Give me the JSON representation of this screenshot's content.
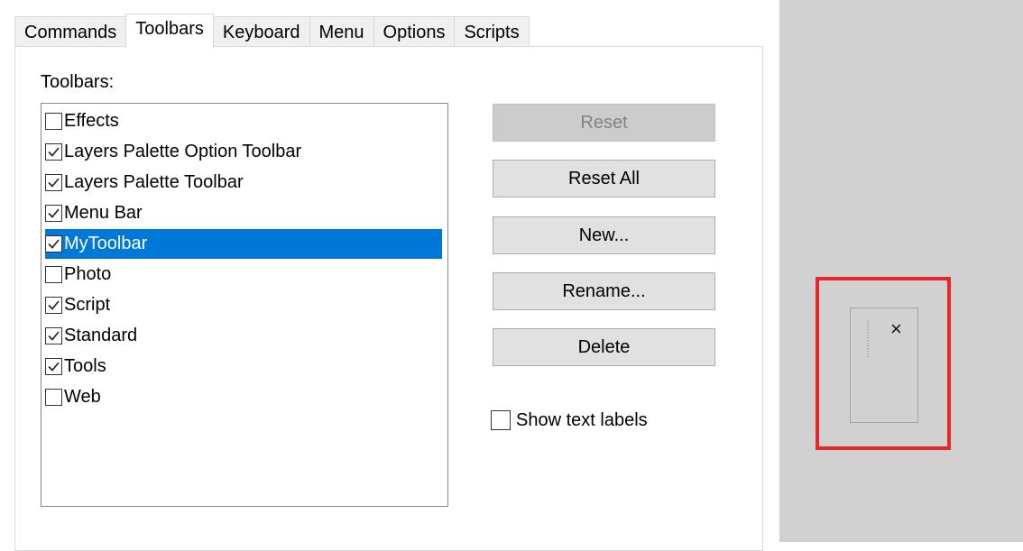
{
  "tabs": [
    {
      "label": "Commands",
      "active": false
    },
    {
      "label": "Toolbars",
      "active": true
    },
    {
      "label": "Keyboard",
      "active": false
    },
    {
      "label": "Menu",
      "active": false
    },
    {
      "label": "Options",
      "active": false
    },
    {
      "label": "Scripts",
      "active": false
    }
  ],
  "toolbars_label": "Toolbars:",
  "toolbars": [
    {
      "label": "Effects",
      "checked": false,
      "selected": false
    },
    {
      "label": "Layers Palette Option Toolbar",
      "checked": true,
      "selected": false
    },
    {
      "label": "Layers Palette Toolbar",
      "checked": true,
      "selected": false
    },
    {
      "label": "Menu Bar",
      "checked": true,
      "selected": false
    },
    {
      "label": "MyToolbar",
      "checked": true,
      "selected": true
    },
    {
      "label": "Photo",
      "checked": false,
      "selected": false
    },
    {
      "label": "Script",
      "checked": true,
      "selected": false
    },
    {
      "label": "Standard",
      "checked": true,
      "selected": false
    },
    {
      "label": "Tools",
      "checked": true,
      "selected": false
    },
    {
      "label": "Web",
      "checked": false,
      "selected": false
    }
  ],
  "buttons": {
    "reset": {
      "label": "Reset",
      "enabled": false
    },
    "reset_all": {
      "label": "Reset All",
      "enabled": true
    },
    "new": {
      "label": "New...",
      "enabled": true
    },
    "rename": {
      "label": "Rename...",
      "enabled": true
    },
    "delete": {
      "label": "Delete",
      "enabled": true
    }
  },
  "show_text_labels": {
    "label": "Show text labels",
    "checked": false
  },
  "floating_toolbar": {
    "close_glyph": "×",
    "highlight_color": "#e8262b"
  },
  "colors": {
    "selection": "#0078d7",
    "workspace": "#d1d1d1"
  },
  "icons": {
    "check": "check-icon",
    "close": "close-icon",
    "grip": "grip-handle-icon"
  }
}
